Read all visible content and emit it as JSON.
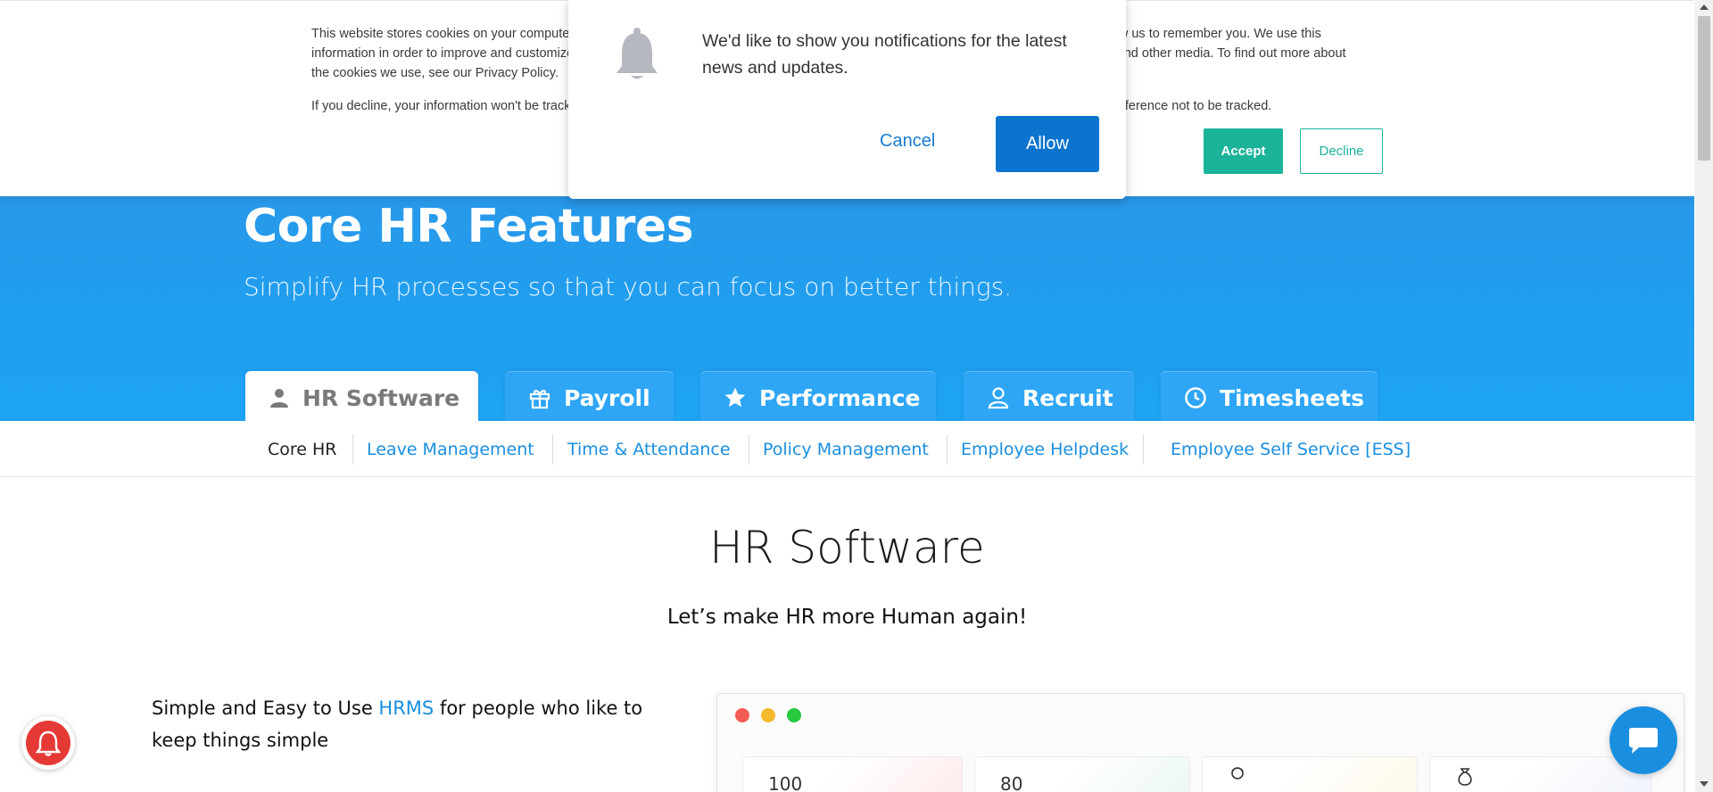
{
  "cookie_banner": {
    "paragraph1": "This website stores cookies on your computer. These cookies are used to collect information about how you interact with our website and allow us to remember you. We use this information in order to improve and customize your browsing experience and for analytics and metrics about our visitors both on this website and other media. To find out more about the cookies we use, see our Privacy Policy.",
    "paragraph2": "If you decline, your information won't be tracked when you visit this website. A single cookie will be used in your browser to remember your preference not to be tracked.",
    "accept_label": "Accept",
    "decline_label": "Decline"
  },
  "notification": {
    "message": "We'd like to show you notifications for the latest news and updates.",
    "cancel_label": "Cancel",
    "allow_label": "Allow"
  },
  "hero": {
    "title": "Core HR Features",
    "subtitle": "Simplify HR processes so that you can focus on better things."
  },
  "tabs": [
    {
      "label": "HR Software",
      "icon": "person-icon",
      "active": true
    },
    {
      "label": "Payroll",
      "icon": "gift-icon",
      "active": false
    },
    {
      "label": "Performance",
      "icon": "star-icon",
      "active": false
    },
    {
      "label": "Recruit",
      "icon": "user-outline-icon",
      "active": false
    },
    {
      "label": "Timesheets",
      "icon": "clock-icon",
      "active": false
    }
  ],
  "subnav": [
    {
      "label": "Core HR",
      "active": true
    },
    {
      "label": "Leave Management",
      "active": false
    },
    {
      "label": "Time & Attendance",
      "active": false
    },
    {
      "label": "Policy Management",
      "active": false
    },
    {
      "label": "Employee Helpdesk",
      "active": false
    },
    {
      "label": "Employee Self Service [ESS]",
      "active": false
    }
  ],
  "main": {
    "title": "HR Software",
    "tagline": "Let’s make HR more Human again!",
    "feature_prefix": "Simple and Easy to Use ",
    "feature_link": "HRMS",
    "feature_suffix": " for people who like to keep things simple"
  },
  "preview": {
    "card1_value": "100",
    "card2_value": "80"
  },
  "colors": {
    "accent_blue": "#1a8fe0",
    "hero_blue": "#1f9ff0",
    "cookie_green": "#1bb39a",
    "allow_blue": "#0c74cf",
    "bell_red": "#e53935"
  }
}
